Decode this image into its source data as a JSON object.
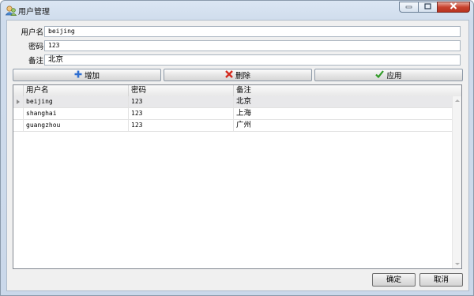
{
  "window": {
    "title": "用户管理"
  },
  "form": {
    "username_label": "用户名",
    "username_value": "beijing",
    "password_label": "密码",
    "password_value": "123",
    "remark_label": "备注",
    "remark_value": "北京"
  },
  "toolbar": {
    "add_label": "增加",
    "delete_label": "删除",
    "apply_label": "应用"
  },
  "grid": {
    "columns": [
      "用户名",
      "密码",
      "备注"
    ],
    "rows": [
      {
        "username": "beijing",
        "password": "123",
        "remark": "北京",
        "selected": true
      },
      {
        "username": "shanghai",
        "password": "123",
        "remark": "上海",
        "selected": false
      },
      {
        "username": "guangzhou",
        "password": "123",
        "remark": "广州",
        "selected": false
      }
    ]
  },
  "dialog": {
    "ok_label": "确定",
    "cancel_label": "取消"
  },
  "icons": {
    "app": "user-manager-icon",
    "add": "plus-icon",
    "delete": "x-icon",
    "apply": "checkmark-icon"
  },
  "colors": {
    "add_icon": "#2f6fd1",
    "delete_icon": "#d42a1e",
    "apply_icon": "#2f9a24",
    "close_button": "#c7432f"
  }
}
